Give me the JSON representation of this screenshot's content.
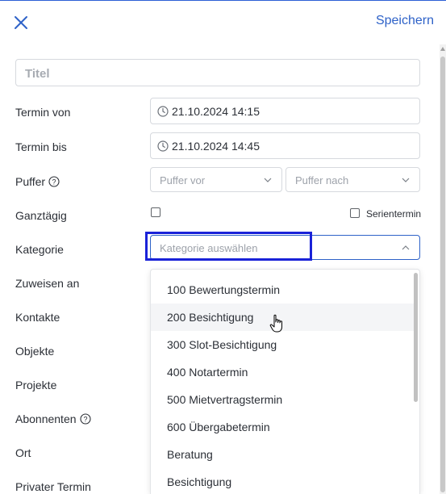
{
  "header": {
    "save_label": "Speichern",
    "close_icon": "close-icon"
  },
  "form": {
    "title_placeholder": "Titel",
    "labels": {
      "termin_von": "Termin von",
      "termin_bis": "Termin bis",
      "puffer": "Puffer",
      "ganztaegig": "Ganztägig",
      "kategorie": "Kategorie",
      "zuweisen_an": "Zuweisen an",
      "kontakte": "Kontakte",
      "objekte": "Objekte",
      "projekte": "Projekte",
      "abonnenten": "Abonnenten",
      "ort": "Ort",
      "privater_termin": "Privater Termin"
    },
    "termin_von_value": "21.10.2024 14:15",
    "termin_bis_value": "21.10.2024 14:45",
    "puffer_vor_placeholder": "Puffer vor",
    "puffer_nach_placeholder": "Puffer nach",
    "serientermin_label": "Serientermin",
    "kategorie_placeholder": "Kategorie auswählen",
    "ganztaegig_checked": false,
    "serientermin_checked": false
  },
  "dropdown": {
    "items": [
      "100 Bewertungstermin",
      "200 Besichtigung",
      "300 Slot-Besichtigung",
      "400 Notartermin",
      "500 Mietvertragstermin",
      "600 Übergabetermin",
      "Beratung",
      "Besichtigung"
    ],
    "hovered_index": 1
  },
  "colors": {
    "accent": "#2e62c8",
    "highlight": "#1a22d8"
  }
}
